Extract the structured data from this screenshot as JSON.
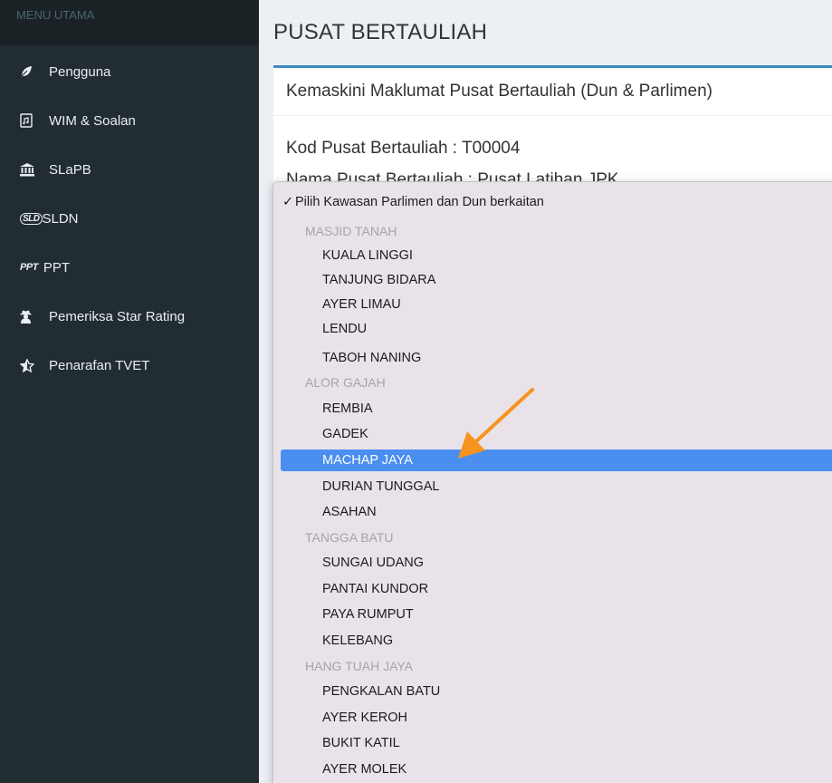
{
  "sidebar": {
    "header": "MENU UTAMA",
    "items": [
      {
        "label": "Pengguna",
        "icon": "leaf-icon"
      },
      {
        "label": "WIM & Soalan",
        "icon": "file-audio-icon"
      },
      {
        "label": "SLaPB",
        "icon": "bank-icon"
      },
      {
        "label": "SLDN",
        "icon": "sldn-logo-icon",
        "icon_text": "SLD"
      },
      {
        "label": "PPT",
        "icon": "ppt-logo-icon",
        "icon_text": "PPT"
      },
      {
        "label": "Pemeriksa Star Rating",
        "icon": "user-secret-icon"
      },
      {
        "label": "Penarafan TVET",
        "icon": "star-half-icon"
      }
    ]
  },
  "main": {
    "title": "PUSAT BERTAULIAH",
    "box_title": "Kemaskini Maklumat Pusat Bertauliah (Dun & Parlimen)",
    "kod_line": "Kod Pusat Bertauliah : T00004",
    "nama_line": "Nama Pusat Bertauliah : Pusat Latihan JPK"
  },
  "dropdown": {
    "prompt": "Pilih Kawasan Parlimen dan Dun berkaitan",
    "groups": [
      {
        "label": "MASJID TANAH",
        "options": [
          "KUALA LINGGI",
          "TANJUNG BIDARA",
          "AYER LIMAU",
          "LENDU",
          "TABOH NANING"
        ]
      },
      {
        "label": "ALOR GAJAH",
        "options": [
          "REMBIA",
          "GADEK",
          "MACHAP JAYA",
          "DURIAN TUNGGAL",
          "ASAHAN"
        ]
      },
      {
        "label": "TANGGA BATU",
        "options": [
          "SUNGAI UDANG",
          "PANTAI KUNDOR",
          "PAYA RUMPUT",
          "KELEBANG"
        ]
      },
      {
        "label": "HANG TUAH JAYA",
        "options": [
          "PENGKALAN BATU",
          "AYER KEROH",
          "BUKIT KATIL",
          "AYER MOLEK"
        ]
      }
    ],
    "selected": "MACHAP JAYA"
  },
  "colors": {
    "sidebar_bg": "#222d32",
    "sidebar_header_bg": "#1a2226",
    "box_accent": "#3c8dbc",
    "selected_bg": "#4a8ef0",
    "arrow": "#f7941d"
  }
}
